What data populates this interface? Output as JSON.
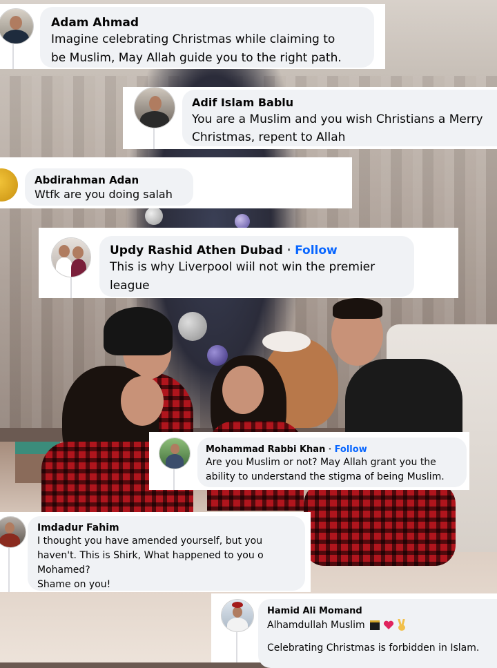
{
  "comments": [
    {
      "name": "Adam Ahmad",
      "text": "Imagine celebrating Christmas while claiming to\nbe Muslim, May Allah guide you to the right path.",
      "avatar": "profile-photo-avatar"
    },
    {
      "name": "Adif Islam Bablu",
      "text": "You are a Muslim and you wish Christians a Merry\nChristmas, repent to Allah",
      "avatar": "profile-photo-avatar"
    },
    {
      "name": "Abdirahman Adan",
      "text": "Wtfk are you doing salah",
      "avatar": "profile-photo-avatar"
    },
    {
      "name": "Updy Rashid Athen Dubad",
      "separator": "·",
      "follow_label": "Follow",
      "text": "This is why Liverpool wiil not win the premier\nleague",
      "avatar": "profile-photo-avatar"
    },
    {
      "name": "Mohammad Rabbi Khan",
      "separator": "·",
      "follow_label": "Follow",
      "text": "Are you Muslim or not? May Allah grant you the\nability to understand the stigma of being Muslim.",
      "avatar": "profile-photo-avatar"
    },
    {
      "name": "Imdadur Fahim",
      "text": "I thought you have amended yourself, but you\nhaven't. This is Shirk, What happened to you o\nMohamed?\nShame on you!",
      "avatar": "profile-photo-avatar"
    },
    {
      "name": "Hamid Ali Momand",
      "text_line1": "Alhamdullah Muslim",
      "emojis": [
        "kaaba-emoji",
        "red-heart-emoji",
        "victory-hand-emoji"
      ],
      "text_line2": "Celebrating Christmas is forbidden in Islam.",
      "avatar": "profile-photo-avatar"
    }
  ],
  "background": {
    "description_icon": "family-christmas-photo"
  },
  "colors": {
    "bubble": "#f0f2f5",
    "follow": "#0866ff",
    "text": "#050505",
    "card": "#ffffff"
  }
}
